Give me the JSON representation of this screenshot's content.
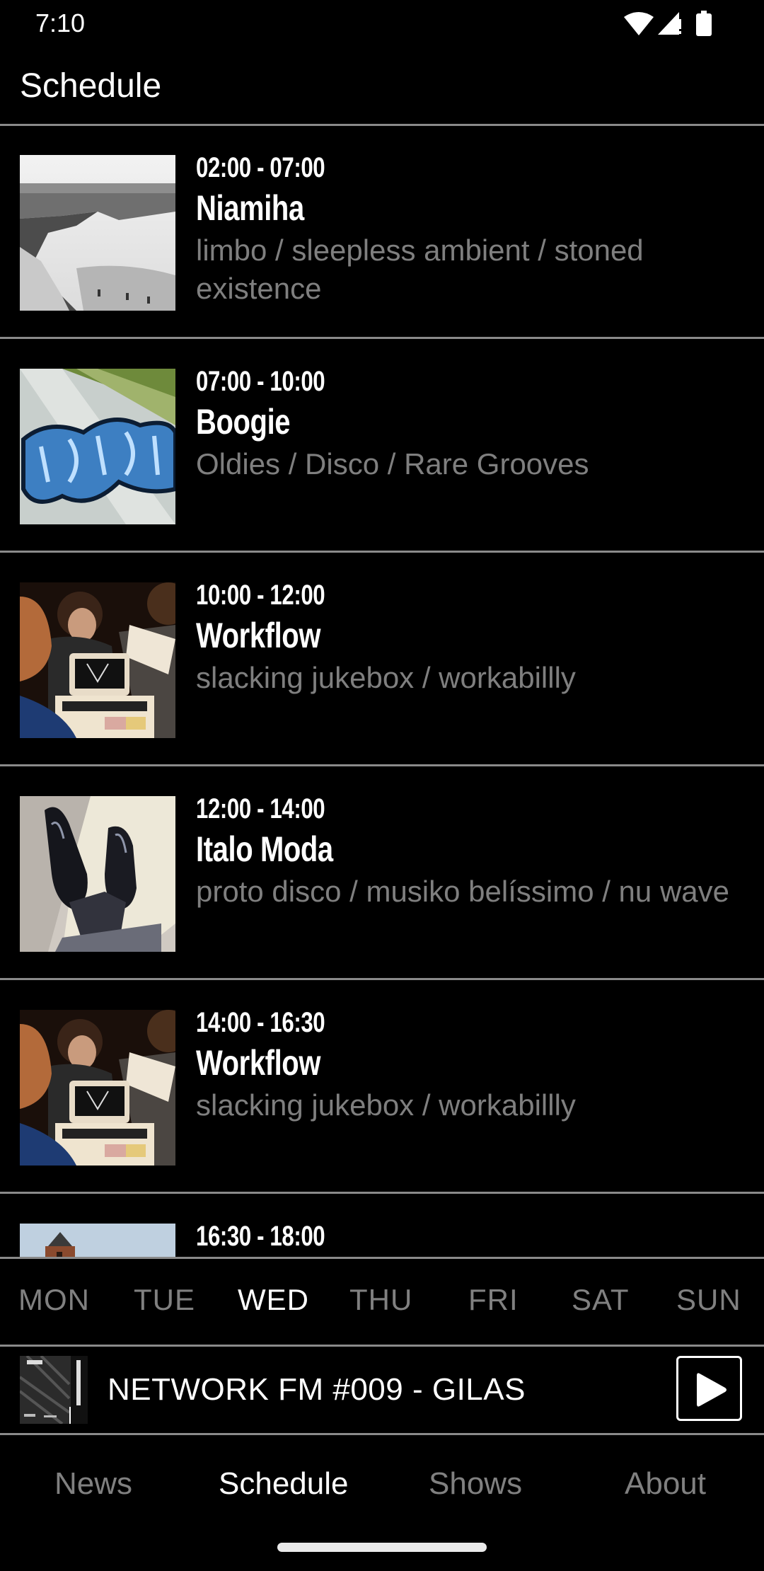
{
  "status_bar": {
    "time": "7:10",
    "icons": [
      "wifi-icon",
      "cell-signal-alert-icon",
      "battery-icon"
    ]
  },
  "app_bar": {
    "title": "Schedule"
  },
  "schedule": [
    {
      "time": "02:00 - 07:00",
      "title": "Niamiha",
      "genres": "limbo / sleepless ambient / stoned existence",
      "artwork": "black-and-white river landscape"
    },
    {
      "time": "07:00 - 10:00",
      "title": "Boogie",
      "genres": "Oldies / Disco / Rare Grooves",
      "artwork": "blue Boogie graffiti"
    },
    {
      "time": "10:00 - 12:00",
      "title": "Workflow",
      "genres": "slacking jukebox / workabillly",
      "artwork": "kids at PET computer"
    },
    {
      "time": "12:00 - 14:00",
      "title": "Italo Moda",
      "genres": "proto disco / musiko belíssimo / nu wave",
      "artwork": "black leather shoes"
    },
    {
      "time": "14:00 - 16:30",
      "title": "Workflow",
      "genres": "slacking jukebox / workabillly",
      "artwork": "kids at PET computer"
    },
    {
      "time": "16:30 - 18:00",
      "title": "",
      "genres": "",
      "artwork": "brick tower against sky"
    }
  ],
  "days": {
    "items": [
      "MON",
      "TUE",
      "WED",
      "THU",
      "FRI",
      "SAT",
      "SUN"
    ],
    "selected": "WED"
  },
  "player": {
    "title": "NETWORK FM #009 - GILAS",
    "artwork": "Network FM GILAS cover",
    "play_icon": "play-icon"
  },
  "bottom_nav": {
    "items": [
      "News",
      "Schedule",
      "Shows",
      "About"
    ],
    "selected": "Schedule"
  },
  "colors": {
    "background": "#000000",
    "primary_text": "#ffffff",
    "secondary_text": "#7f7f7f",
    "divider": "#8a8a8a"
  }
}
